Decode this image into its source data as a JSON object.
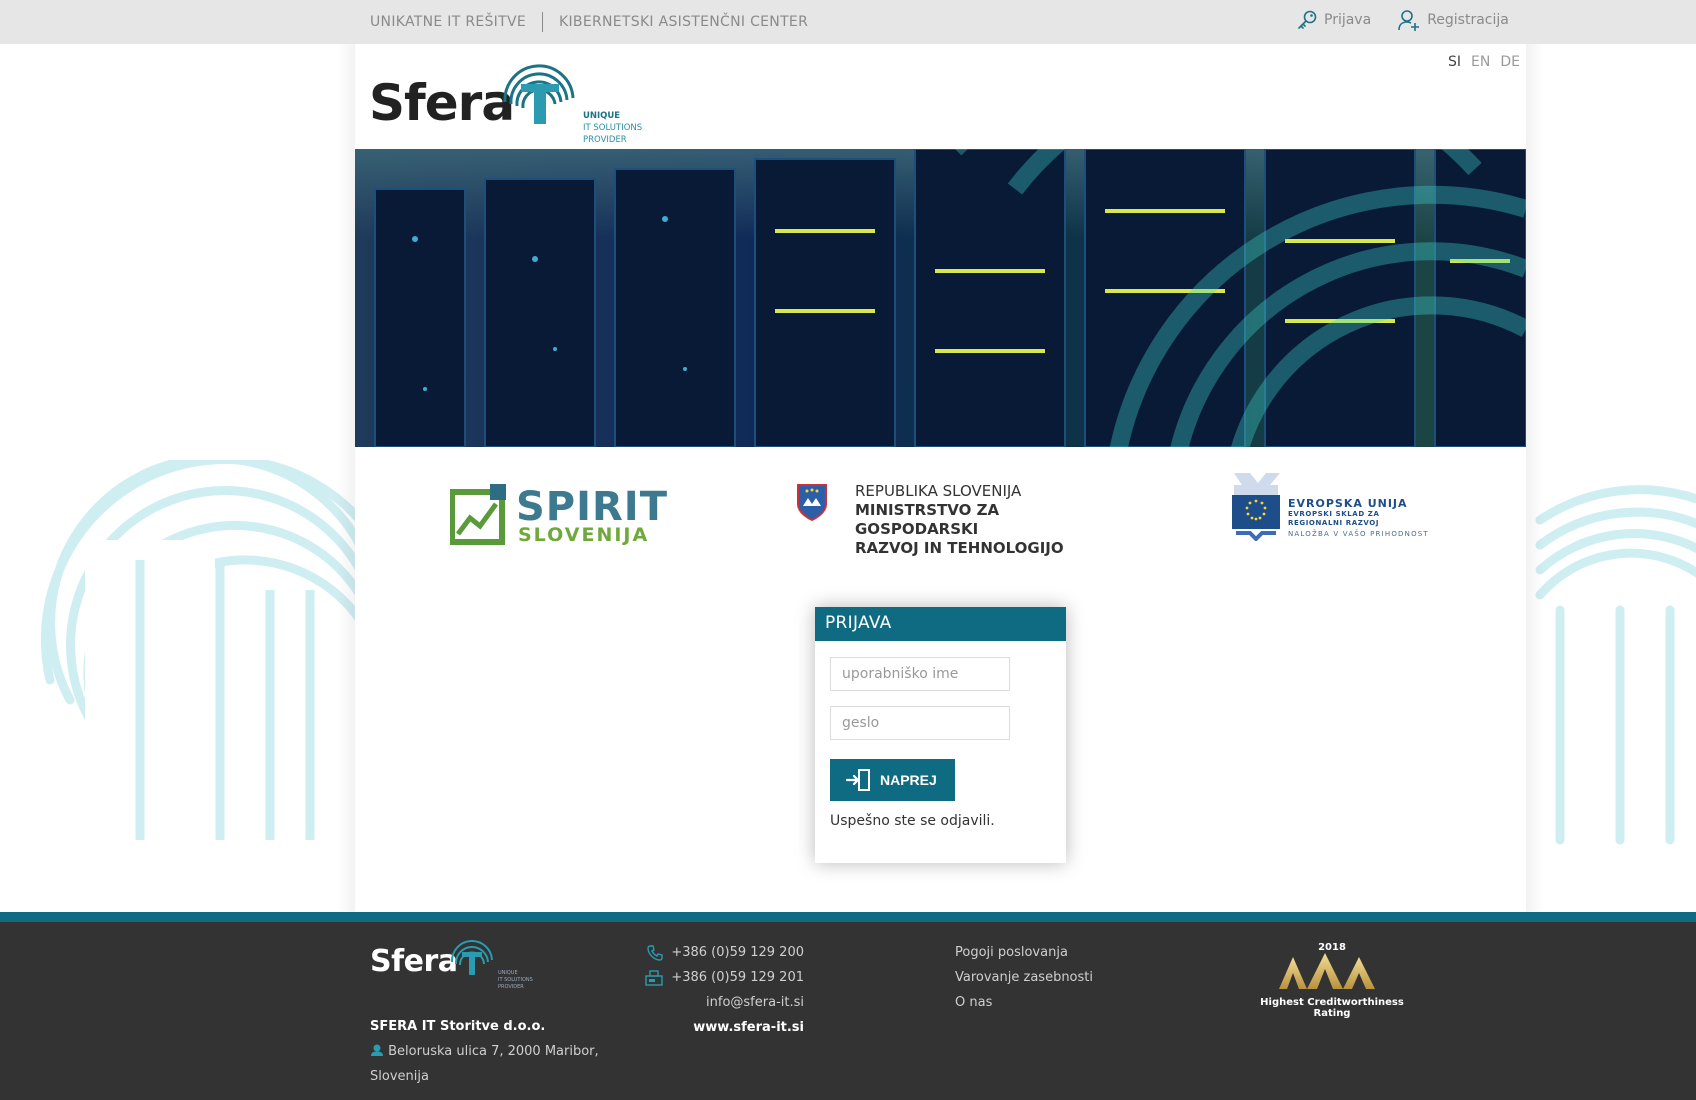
{
  "topnav": {
    "items": [
      "UNIKATNE IT REŠITVE",
      "KIBERNETSKI ASISTENČNI CENTER"
    ]
  },
  "user_links": {
    "login": "Prijava",
    "register": "Registracija"
  },
  "logo": {
    "word": "Sfera",
    "tag_line1": "UNIQUE",
    "tag_line2": "IT SOLUTIONS",
    "tag_line3": "PROVIDER"
  },
  "languages": {
    "si": "SI",
    "en": "EN",
    "de": "DE",
    "active": "SI"
  },
  "sponsors": {
    "spirit_line1": "SPIRIT",
    "spirit_line2": "SLOVENIJA",
    "ministry_line1": "REPUBLIKA SLOVENIJA",
    "ministry_line2": "MINISTRSTVO ZA GOSPODARSKI",
    "ministry_line3": "RAZVOJ IN TEHNOLOGIJO",
    "eu_line1": "EVROPSKA UNIJA",
    "eu_line2": "EVROPSKI SKLAD ZA",
    "eu_line3": "REGIONALNI RAZVOJ",
    "eu_line4": "NALOŽBA V VAŠO PRIHODNOST"
  },
  "login": {
    "title": "PRIJAVA",
    "username_placeholder": "uporabniško ime",
    "password_placeholder": "geslo",
    "submit_label": "NAPREJ",
    "message": "Uspešno ste se odjavili."
  },
  "footer": {
    "logo_word": "Sfera",
    "logo_tag1": "UNIQUE",
    "logo_tag2": "IT SOLUTIONS",
    "logo_tag3": "PROVIDER",
    "company_name": "SFERA IT Storitve d.o.o.",
    "address_line1": "Beloruska ulica 7, 2000 Maribor,",
    "address_line2": "Slovenija",
    "phone": "+386 (0)59 129 200",
    "fax": "+386 (0)59 129 201",
    "email": "info@sfera-it.si",
    "website": "www.sfera-it.si",
    "links": [
      "Pogoji poslovanja",
      "Varovanje zasebnosti",
      "O nas"
    ],
    "rating_year": "2018",
    "rating_caption": "Highest Creditworthiness Rating"
  },
  "colors": {
    "brand_teal": "#0f6b82",
    "topbar_bg": "#e6e6e6",
    "footer_bg": "#333333"
  }
}
